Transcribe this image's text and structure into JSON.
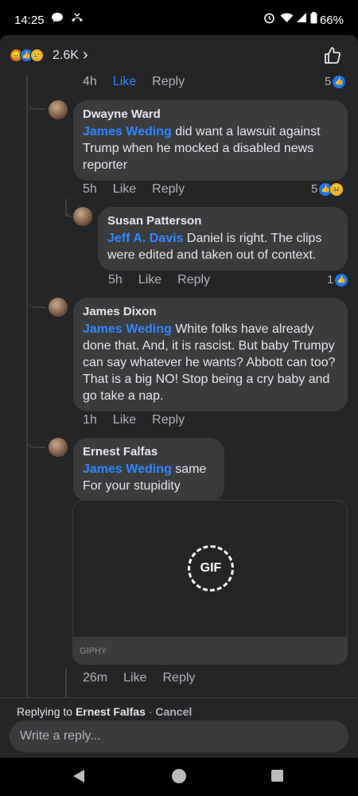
{
  "status": {
    "time": "14:25",
    "battery": "66%"
  },
  "header": {
    "reaction_count": "2.6K",
    "chevron": "›"
  },
  "comments": [
    {
      "actions": {
        "time": "4h",
        "like": "Like",
        "reply": "Reply"
      },
      "reactions": "5"
    },
    {
      "author": "Dwayne Ward",
      "mention": "James Weding",
      "text": " did want a lawsuit against Trump when he mocked a disabled news reporter",
      "actions": {
        "time": "5h",
        "like": "Like",
        "reply": "Reply"
      },
      "reactions": "5"
    },
    {
      "author": "Susan Patterson",
      "mention": "Jeff A. Davis",
      "text": " Daniel is right. The clips were edited and taken out of context.",
      "actions": {
        "time": "5h",
        "like": "Like",
        "reply": "Reply"
      },
      "reactions": "1"
    },
    {
      "author": "James Dixon",
      "mention": "James Weding",
      "text": " White folks have already done that.  And, it is rascist.  But baby Trumpy can say whatever he wants? Abbott can too?  That is a big NO!  Stop being a cry baby and go take a nap.",
      "actions": {
        "time": "1h",
        "like": "Like",
        "reply": "Reply"
      }
    },
    {
      "author": "Ernest Falfas",
      "mention": "James Weding",
      "text": " same For your stupidity",
      "gif_label": "GIF",
      "gif_source": "GIPHY",
      "actions": {
        "time": "26m",
        "like": "Like",
        "reply": "Reply"
      }
    }
  ],
  "composer": {
    "replying_prefix": "Replying to ",
    "replying_name": "Ernest Falfas",
    "separator": " · ",
    "cancel": "Cancel",
    "placeholder": "Write a reply..."
  },
  "colors": {
    "accent": "#2d88ff",
    "background": "#242526",
    "bubble": "#3a3b3c"
  }
}
